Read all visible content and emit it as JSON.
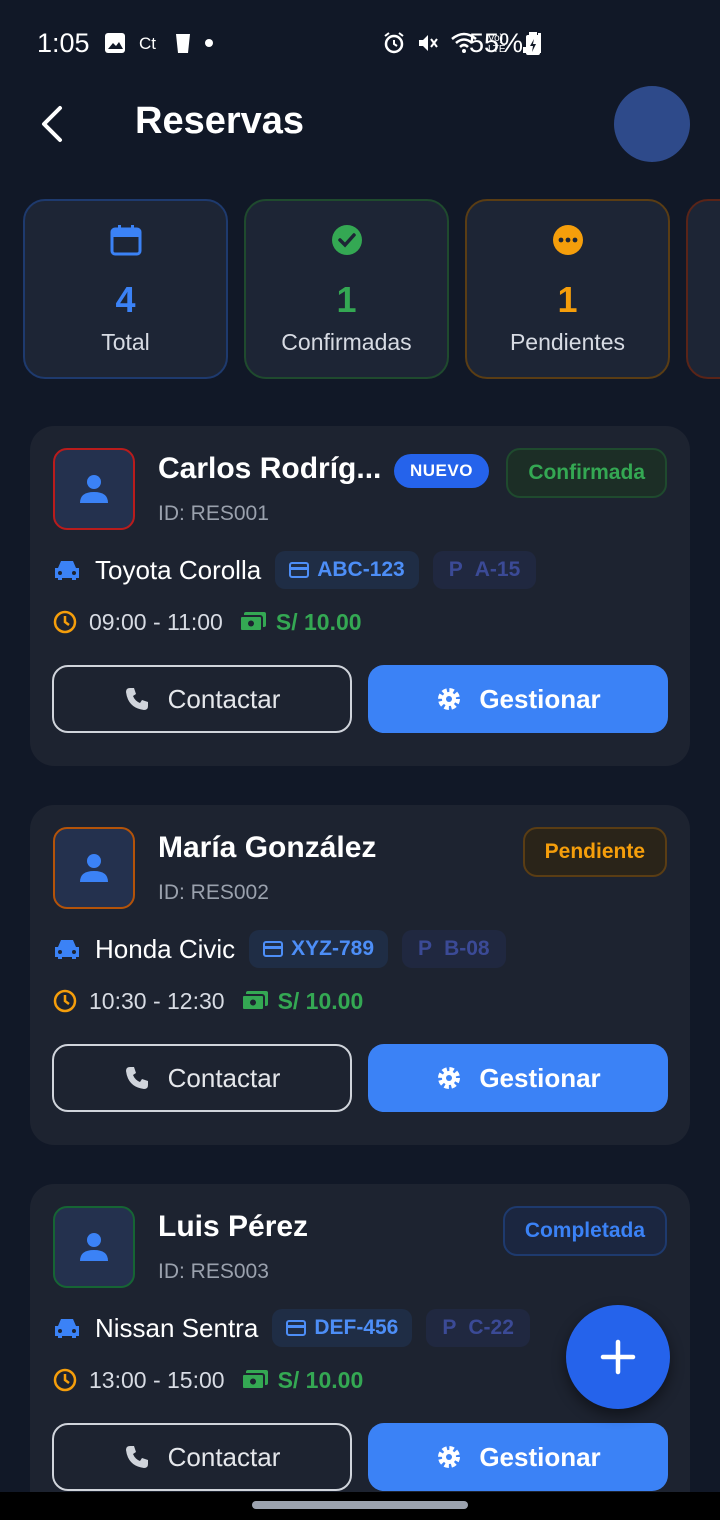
{
  "status_bar": {
    "time": "1:05",
    "battery": "55%"
  },
  "header": {
    "title": "Reservas"
  },
  "stats": [
    {
      "value": "4",
      "label": "Total",
      "color": "#3b82f6",
      "icon": "calendar-icon"
    },
    {
      "value": "1",
      "label": "Confirmadas",
      "color": "#34a853",
      "icon": "check-circle-icon"
    },
    {
      "value": "1",
      "label": "Pendientes",
      "color": "#f59e0b",
      "icon": "more-circle-icon"
    }
  ],
  "reservations": [
    {
      "name": "Carlos Rodríg...",
      "id": "ID: RES001",
      "badge": "NUEVO",
      "status": "Confirmada",
      "status_color": "#34a853",
      "avatar_border": "#b91c1c",
      "car": "Toyota Corolla",
      "plate": "ABC-123",
      "spot_letter": "P",
      "spot": "A-15",
      "time": "09:00 - 11:00",
      "price": "S/ 10.00",
      "contact_label": "Contactar",
      "manage_label": "Gestionar"
    },
    {
      "name": "María González",
      "id": "ID: RES002",
      "status": "Pendiente",
      "status_color": "#f59e0b",
      "avatar_border": "#b45309",
      "car": "Honda Civic",
      "plate": "XYZ-789",
      "spot_letter": "P",
      "spot": "B-08",
      "time": "10:30 - 12:30",
      "price": "S/ 10.00",
      "contact_label": "Contactar",
      "manage_label": "Gestionar"
    },
    {
      "name": "Luis Pérez",
      "id": "ID: RES003",
      "status": "Completada",
      "status_color": "#3b82f6",
      "avatar_border": "#166534",
      "car": "Nissan Sentra",
      "plate": "DEF-456",
      "spot_letter": "P",
      "spot": "C-22",
      "time": "13:00 - 15:00",
      "price": "S/ 10.00",
      "contact_label": "Contactar",
      "manage_label": "Gestionar"
    }
  ]
}
